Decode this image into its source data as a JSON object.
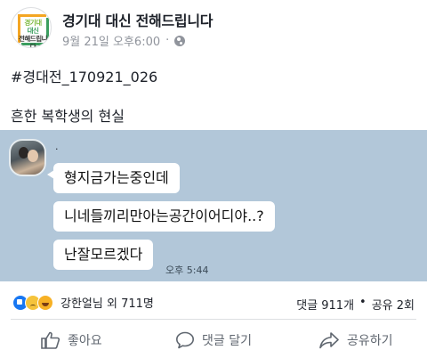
{
  "page": {
    "name": "경기대 대신 전해드립니다",
    "logo_lines": [
      "경기대",
      "대신",
      "전해드립니다"
    ],
    "date": "9월 21일 오후6:00",
    "separator": "·",
    "privacy_icon": "globe-icon"
  },
  "post": {
    "hashtag": "#경대전_170921_026",
    "text": "흔한 복학생의 현실"
  },
  "chat": {
    "sender": ".",
    "messages": [
      "형지금가는중인데",
      "니네들끼리만아는공간이어디야..?",
      "난잘모르겠다"
    ],
    "time": "오후 5:44"
  },
  "reactions": {
    "icons": [
      "like-icon",
      "sad-icon",
      "laugh-icon"
    ],
    "summary": "강한얼님 외 711명",
    "comments": "댓글 911개",
    "shares": "공유 2회",
    "separator": "•"
  },
  "actions": {
    "like": "좋아요",
    "comment": "댓글 달기",
    "share": "공유하기"
  },
  "colors": {
    "chat_background": "#b2c7d9",
    "meta_text": "#90949c",
    "action_text": "#606770",
    "like_blue": "#1877f2"
  }
}
